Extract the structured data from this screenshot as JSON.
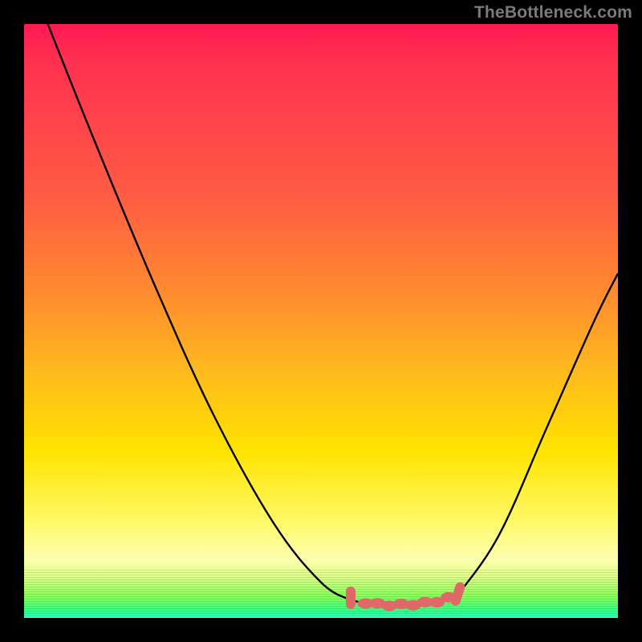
{
  "watermark": "TheBottleneck.com",
  "colors": {
    "background": "#000000",
    "curve_stroke": "#000000",
    "marker_fill": "#e06868",
    "watermark_text": "#7a7a7a"
  },
  "chart_data": {
    "type": "line",
    "title": "",
    "xlabel": "",
    "ylabel": "",
    "xlim": [
      0,
      100
    ],
    "ylim": [
      0,
      100
    ],
    "grid": false,
    "legend": false,
    "curve": {
      "segment_left": [
        {
          "x": 4,
          "y": 100
        },
        {
          "x": 12,
          "y": 80
        },
        {
          "x": 22,
          "y": 56
        },
        {
          "x": 32,
          "y": 34
        },
        {
          "x": 42,
          "y": 16
        },
        {
          "x": 50,
          "y": 6
        },
        {
          "x": 55,
          "y": 3
        }
      ],
      "trough": [
        {
          "x": 55,
          "y": 3
        },
        {
          "x": 58,
          "y": 2.4
        },
        {
          "x": 62,
          "y": 2.2
        },
        {
          "x": 66,
          "y": 2.3
        },
        {
          "x": 70,
          "y": 2.8
        },
        {
          "x": 73,
          "y": 3.8
        }
      ],
      "segment_right": [
        {
          "x": 73,
          "y": 3.8
        },
        {
          "x": 80,
          "y": 14
        },
        {
          "x": 88,
          "y": 32
        },
        {
          "x": 96,
          "y": 50
        },
        {
          "x": 100,
          "y": 58
        }
      ]
    },
    "markers": [
      {
        "x": 55,
        "y": 3.4
      },
      {
        "x": 57.5,
        "y": 2.6
      },
      {
        "x": 59.5,
        "y": 2.3
      },
      {
        "x": 61.5,
        "y": 2.2
      },
      {
        "x": 63.5,
        "y": 2.2
      },
      {
        "x": 65.5,
        "y": 2.3
      },
      {
        "x": 67.5,
        "y": 2.5
      },
      {
        "x": 69.5,
        "y": 2.8
      },
      {
        "x": 71.5,
        "y": 3.3
      },
      {
        "x": 73,
        "y": 3.9
      }
    ]
  }
}
